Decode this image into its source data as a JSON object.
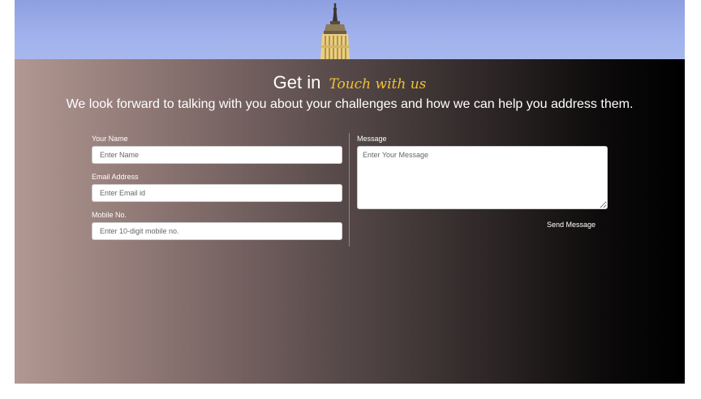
{
  "hero": {
    "image": "capitol-dome-statue",
    "sky_color": "#9fb0ec"
  },
  "heading": {
    "main": "Get in",
    "script": "Touch with us",
    "script_color": "#f2c12e"
  },
  "subtitle": "We look forward to talking with you about your challenges and how we can help you address them.",
  "form": {
    "name": {
      "label": "Your Name",
      "placeholder": "Enter Name",
      "value": ""
    },
    "email": {
      "label": "Email Address",
      "placeholder": "Enter Email id",
      "value": ""
    },
    "mobile": {
      "label": "Mobile No.",
      "placeholder": "Enter 10-digit mobile no.",
      "value": ""
    },
    "message": {
      "label": "Message",
      "placeholder": "Enter Your Message",
      "value": ""
    },
    "submit_label": "Send Message"
  }
}
